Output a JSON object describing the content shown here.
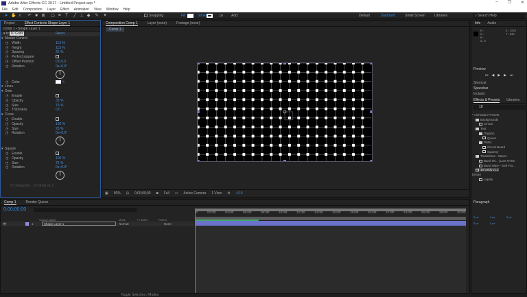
{
  "window": {
    "title": "Adobe After Effects CC 2017 - Untitled Project.aep *",
    "controls": [
      "–",
      "❐",
      "✕"
    ]
  },
  "menu": [
    "File",
    "Edit",
    "Composition",
    "Layer",
    "Effect",
    "Animation",
    "View",
    "Window",
    "Help"
  ],
  "toolbar": {
    "snapping": "Snapping",
    "fill": "Fill",
    "stroke": "Stroke",
    "stroke_px": "px",
    "add": "Add:"
  },
  "workspaces": {
    "items": [
      "Default",
      "Standard",
      "Small Screen",
      "Libraries"
    ],
    "active": "Standard",
    "search_placeholder": "Search Help"
  },
  "left_panel": {
    "tabs": [
      "Project",
      "Effect Controls Shape Layer 1"
    ],
    "breadcrumb": "Comp 1 • Shape Layer 1",
    "effect_name": "10 Grids",
    "reset": "Reset",
    "rows": [
      {
        "label": "Master Control",
        "indent": 1,
        "type": "group"
      },
      {
        "label": "Width",
        "indent": 2,
        "value": "113 %"
      },
      {
        "label": "Height",
        "indent": 2,
        "value": "113 %"
      },
      {
        "label": "Spacing",
        "indent": 2,
        "value": "25 %"
      },
      {
        "label": "Perfect square",
        "indent": 2,
        "type": "check"
      },
      {
        "label": "Offset Position",
        "indent": 2,
        "value": "0.0,0.0"
      },
      {
        "label": "Rotation",
        "indent": 2,
        "value": "0x+0.0°",
        "dial": true
      },
      {
        "label": "Color",
        "indent": 2,
        "type": "color"
      },
      {
        "label": "Lines",
        "indent": 1,
        "type": "group"
      },
      {
        "label": "Dots",
        "indent": 1,
        "type": "group"
      },
      {
        "label": "Enable",
        "indent": 2,
        "type": "check"
      },
      {
        "label": "Opacity",
        "indent": 2,
        "value": "33 %"
      },
      {
        "label": "Size",
        "indent": 2,
        "value": "75 %"
      },
      {
        "label": "Thickness",
        "indent": 2,
        "value": "0.0"
      },
      {
        "label": "Cross",
        "indent": 1,
        "type": "group"
      },
      {
        "label": "Enable",
        "indent": 2,
        "type": "check"
      },
      {
        "label": "Opacity",
        "indent": 2,
        "value": "100 %"
      },
      {
        "label": "Size",
        "indent": 2,
        "value": "25 %"
      },
      {
        "label": "Rotation",
        "indent": 2,
        "value": "0x+0.0°",
        "dial": true
      },
      {
        "label": "Square",
        "indent": 1,
        "type": "group"
      },
      {
        "label": "Enable",
        "indent": 2,
        "type": "check"
      },
      {
        "label": "Opacity",
        "indent": 2,
        "value": "100 %"
      },
      {
        "label": "Size",
        "indent": 2,
        "value": "75 %"
      },
      {
        "label": "Rotation",
        "indent": 2,
        "value": "0x+0.0°",
        "dial": true
      }
    ],
    "footer": "© Oakleyster · 10 Grids v1.2"
  },
  "viewer": {
    "tabs": [
      "Composition Comp 1",
      "Layer (none)",
      "Footage (none)"
    ],
    "subtab": "Comp 1",
    "zoom": "50%",
    "timecode": "0;00;00;00",
    "resolution": "Full",
    "camera": "Active Camera",
    "views": "1 View",
    "exposure": "+0.0"
  },
  "info": {
    "tabs": [
      "Info",
      "Audio"
    ],
    "channels": [
      "R :",
      "G :",
      "B :",
      "A : 0"
    ],
    "x": "X : 1576",
    "y": "Y : 836"
  },
  "preview": {
    "title": "Preview",
    "shortcut_label": "Shortcut",
    "shortcut": "Spacebar",
    "include": "Include:"
  },
  "effects_presets": {
    "tabs": [
      "Effects & Presets",
      "Libraries"
    ],
    "search": "10",
    "tree": [
      {
        "label": "* Animation Presets",
        "indent": 0
      },
      {
        "label": "Backgrounds",
        "indent": 1,
        "folder": true
      },
      {
        "label": "Circuit",
        "indent": 2
      },
      {
        "label": "Text",
        "indent": 1,
        "folder": true
      },
      {
        "label": "Organic",
        "indent": 2,
        "folder": true
      },
      {
        "label": "Quiver",
        "indent": 3
      },
      {
        "label": "Paths",
        "indent": 2,
        "folder": true
      },
      {
        "label": "Circuit Board",
        "indent": 3
      },
      {
        "label": "Squirmy",
        "indent": 3
      },
      {
        "label": "Transitions - Wipes",
        "indent": 1,
        "folder": true
      },
      {
        "label": "Band Wi... (Lum NTSC",
        "indent": 2
      },
      {
        "label": "Band Wipe - Soft Fra...",
        "indent": 2
      },
      {
        "label": "10 Grids v1.2",
        "indent": 1,
        "selected": true
      },
      {
        "label": "Distort",
        "indent": 0
      },
      {
        "label": "Liquify",
        "indent": 2
      }
    ]
  },
  "paragraph": {
    "title": "Paragraph",
    "fields": [
      "0 px",
      "0 px",
      "0 px",
      "0 px",
      "0 px"
    ]
  },
  "timeline": {
    "tabs": [
      "Comp 1",
      "Render Queue"
    ],
    "timecode": "0;00;00;00",
    "columns": {
      "name": "Source Name",
      "mode": "Mode",
      "trkmat": "T TrkMat",
      "parent": "Parent"
    },
    "layer": {
      "index": "1",
      "name": "Shape Layer 1",
      "mode": "Normal",
      "parent": "None"
    },
    "ruler": [
      "0f",
      "02:00f",
      "04:00f",
      "06:00f",
      "08:00f",
      "10:00f",
      "12:00f",
      "14:00f",
      "16:00f",
      "18:00f",
      "20:00f",
      "22:00f",
      "24:00f",
      "26:00f",
      "28:00f",
      "30:00f"
    ],
    "footer": "Toggle Switches / Modes"
  },
  "colors": {
    "accent": "#2d8ceb",
    "layer_bar": "#6b72c9",
    "workarea": "#3fa86a"
  }
}
